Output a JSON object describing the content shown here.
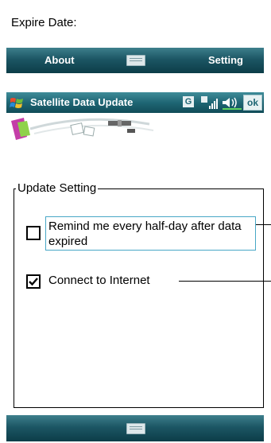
{
  "top_fragment": {
    "expire_label": "Expire Date:",
    "softkey_left": "About",
    "softkey_right": "Setting"
  },
  "titlebar": {
    "title": "Satellite Data Update",
    "g_icon_text": "G",
    "ok_label": "ok"
  },
  "update_setting": {
    "group_label": "Update Setting",
    "remind_label": "Remind me every half-day after data expired",
    "remind_checked": false,
    "connect_label": "Connect to Internet",
    "connect_checked": true
  },
  "colors": {
    "bar_teal": "#1c5664",
    "focus_outline": "#48a7c6"
  },
  "icons": [
    "windows-start-icon",
    "g-network-icon",
    "signal-strength-icon",
    "speaker-icon",
    "keyboard-icon",
    "satellite-icon",
    "phone-icon"
  ]
}
